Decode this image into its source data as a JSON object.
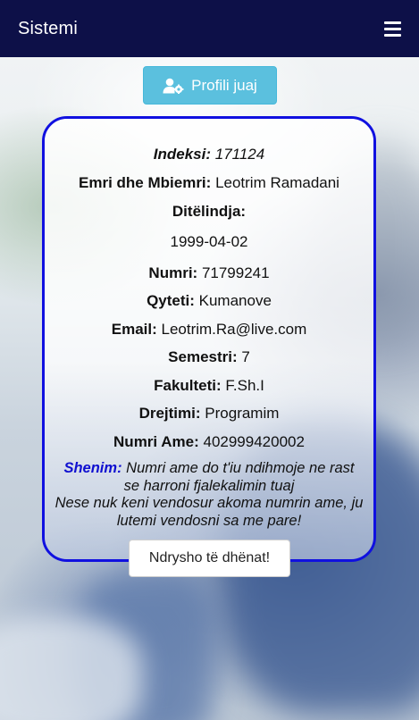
{
  "navbar": {
    "brand": "Sistemi",
    "menu_icon": "hamburger-menu-icon"
  },
  "profile_button": {
    "label": "Profili juaj",
    "icon": "user-gear-icon",
    "color": "#5bc0de"
  },
  "profile": {
    "index_label": "Indeksi:",
    "index_value": "171124",
    "name_label": "Emri dhe Mbiemri:",
    "name_value": "Leotrim Ramadani",
    "birthdate_label": "Ditëlindja:",
    "birthdate_value": "1999-04-02",
    "number_label": "Numri:",
    "number_value": "71799241",
    "city_label": "Qyteti:",
    "city_value": "Kumanove",
    "email_label": "Email:",
    "email_value": "Leotrim.Ra@live.com",
    "semester_label": "Semestri:",
    "semester_value": "7",
    "faculty_label": "Fakulteti:",
    "faculty_value": "F.Sh.I",
    "direction_label": "Drejtimi:",
    "direction_value": "Programim",
    "mother_number_label": "Numri Ame:",
    "mother_number_value": "402999420002"
  },
  "note": {
    "label": "Shenim:",
    "line1": "Numri ame do t'iu ndihmoje ne rast",
    "line2": "se harroni fjalekalimin tuaj",
    "line3": "Nese nuk keni vendosur akoma numrin ame, ju",
    "line4": "lutemi vendosni sa me pare!"
  },
  "edit_button": {
    "label": "Ndrysho të dhënat!"
  },
  "colors": {
    "navbar": "#0d1048",
    "card_border": "#1010e0",
    "note_label": "#1010d0"
  }
}
